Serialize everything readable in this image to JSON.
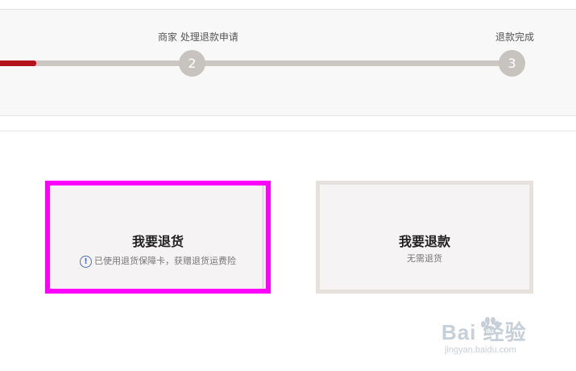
{
  "progress": {
    "fill_fraction": 0.07,
    "steps": [
      {
        "number": "2",
        "label": "商家 处理退款申请"
      },
      {
        "number": "3",
        "label": "退款完成"
      }
    ]
  },
  "options": [
    {
      "title": "我要退货",
      "note": "已使用退货保障卡，获赠退货运费险",
      "note_icon": "info-icon",
      "selected": true
    },
    {
      "title": "我要退款",
      "note": "无需退货",
      "selected": false
    }
  ],
  "watermark": {
    "brand": "Bai 经验",
    "url": "jingyan.baidu.com"
  },
  "colors": {
    "accent_red": "#b3141b",
    "highlight_magenta": "#ff00ff",
    "step_grey": "#c7c3be",
    "info_blue": "#4a6fbf"
  }
}
